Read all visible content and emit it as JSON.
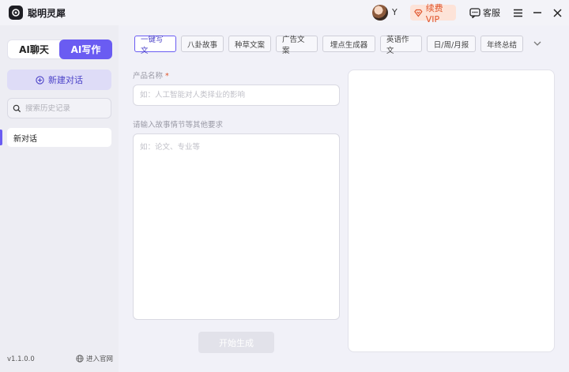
{
  "app": {
    "title": "聪明灵犀"
  },
  "header": {
    "user_name": "Y",
    "vip_label": "续费VIP",
    "service_label": "客服"
  },
  "sidebar": {
    "mode_chat": "AI聊天",
    "mode_write": "AI写作",
    "new_chat": "新建对话",
    "search_placeholder": "搜索历史记录",
    "conversations": [
      {
        "label": "新对话"
      }
    ],
    "version": "v1.1.0.0",
    "official_link": "进入官网"
  },
  "main": {
    "tabs": [
      {
        "label": "一键写文"
      },
      {
        "label": "八卦故事"
      },
      {
        "label": "种草文案"
      },
      {
        "label": "广告文案"
      },
      {
        "label": "埋点生成器"
      },
      {
        "label": "英语作文"
      },
      {
        "label": "日/周/月报"
      },
      {
        "label": "年终总结"
      }
    ],
    "product_label": "产品名称",
    "product_required": "*",
    "product_placeholder": "如：人工智能对人类择业的影响",
    "requirement_label": "请输入故事情节等其他要求",
    "requirement_placeholder": "如：论文、专业等",
    "generate_button": "开始生成"
  },
  "colors": {
    "accent": "#6a5cf2",
    "vip": "#e0542a"
  }
}
